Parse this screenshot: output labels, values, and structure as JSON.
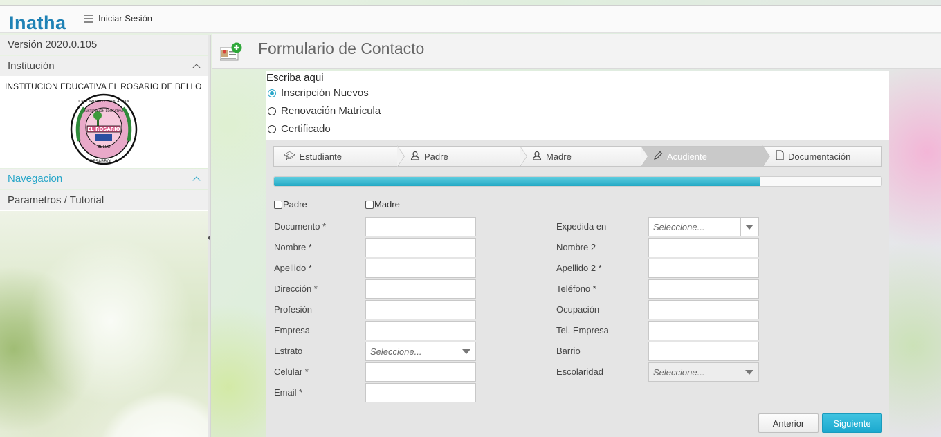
{
  "app": {
    "logo_text": "Inatha",
    "login_label": "Iniciar Sesión"
  },
  "sidebar": {
    "version": "Versión 2020.0.105",
    "institution_header": "Institución",
    "institution_name": "INSTITUCION EDUCATIVA EL ROSARIO DE BELLO",
    "seal_text": {
      "top": "CRECIMIENTO EDUCACION",
      "inner": "INSTITUCION EDUCATIVA",
      "name": "EL ROSARIO",
      "city": "BELLO",
      "bottom": "DESARROLLO"
    },
    "nav_header": "Navegacion",
    "nav_item": "Parametros / Tutorial"
  },
  "header": {
    "title": "Formulario de Contacto",
    "icon": "add-contact-icon"
  },
  "request_type": {
    "label": "Escriba aqui",
    "options": [
      {
        "label": "Inscripción Nuevos",
        "checked": true
      },
      {
        "label": "Renovación Matricula",
        "checked": false
      },
      {
        "label": "Certificado",
        "checked": false
      }
    ]
  },
  "steps": [
    {
      "label": "Estudiante",
      "icon": "graduation-cap-icon",
      "active": false
    },
    {
      "label": "Padre",
      "icon": "user-icon",
      "active": false
    },
    {
      "label": "Madre",
      "icon": "user-icon",
      "active": false
    },
    {
      "label": "Acudiente",
      "icon": "pencil-icon",
      "active": true
    },
    {
      "label": "Documentación",
      "icon": "document-icon",
      "active": false
    }
  ],
  "progress": 0.8,
  "copy_from": {
    "padre": "Padre",
    "madre": "Madre"
  },
  "left_fields": [
    {
      "label": "Documento *",
      "type": "text",
      "value": ""
    },
    {
      "label": "Nombre *",
      "type": "text",
      "value": ""
    },
    {
      "label": "Apellido *",
      "type": "text",
      "value": ""
    },
    {
      "label": "Dirección *",
      "type": "text",
      "value": ""
    },
    {
      "label": "Profesión",
      "type": "text",
      "value": ""
    },
    {
      "label": "Empresa",
      "type": "text",
      "value": ""
    },
    {
      "label": "Estrato",
      "type": "select",
      "placeholder": "Seleccione..."
    },
    {
      "label": "Celular *",
      "type": "text",
      "value": ""
    },
    {
      "label": "Email *",
      "type": "text",
      "value": ""
    }
  ],
  "right_fields": [
    {
      "label": "Expedida en",
      "type": "select",
      "placeholder": "Seleccione..."
    },
    {
      "label": "Nombre 2",
      "type": "text",
      "value": ""
    },
    {
      "label": "Apellido 2 *",
      "type": "text",
      "value": ""
    },
    {
      "label": "Teléfono *",
      "type": "text",
      "value": ""
    },
    {
      "label": "Ocupación",
      "type": "text",
      "value": ""
    },
    {
      "label": "Tel. Empresa",
      "type": "text",
      "value": ""
    },
    {
      "label": "Barrio",
      "type": "text",
      "value": ""
    },
    {
      "label": "Escolaridad",
      "type": "select",
      "placeholder": "Seleccione..."
    }
  ],
  "buttons": {
    "previous": "Anterior",
    "next": "Siguiente"
  },
  "colors": {
    "accent": "#2aa7c9",
    "brand": "#1f82b5",
    "next_button": "#1ca8cf"
  }
}
